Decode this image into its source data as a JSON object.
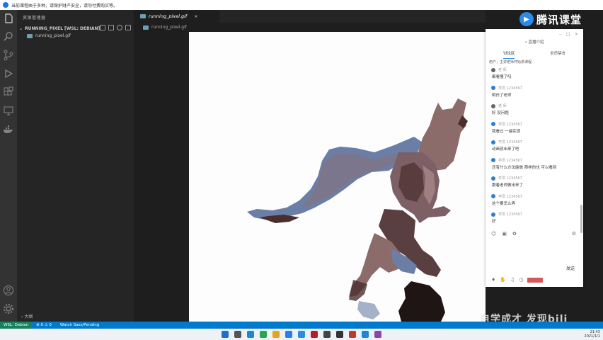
{
  "notice": {
    "text": "当前课程由于多种，请保护财产安全，请勿付费购买等。"
  },
  "explorer": {
    "header": "资源管理器",
    "folder": "RUNNING_PIXEL [WSL: DEBIAN]",
    "file": "running_pixel.gif",
    "outline": "大纲"
  },
  "editor": {
    "tab_label": "running_pixel.gif",
    "breadcrumb": "running_pixel.gif"
  },
  "status": {
    "remote": "WSL: Debian",
    "problems": "⊗ 0 ⚠ 0",
    "branch": "Watch Sass/Pending"
  },
  "brand": {
    "name": "腾讯课堂"
  },
  "chat": {
    "title": "• 直播介绍",
    "tab_discussion": "讨论区",
    "tab_other": "全员禁言",
    "top_line": "用户，主讲老师开始讲课程",
    "send_label": "发送",
    "messages": [
      {
        "user": "老 师",
        "text": "都看懂了吗",
        "teacher": true
      },
      {
        "user": "学员 1234567",
        "text": "明白了老师",
        "teacher": false
      },
      {
        "user": "老 师",
        "text": "好 没问题",
        "teacher": true
      },
      {
        "user": "学员 1234567",
        "text": "我看过 一遍实现",
        "teacher": false
      },
      {
        "user": "学员 1234567",
        "text": "动画就出来了吧",
        "teacher": false
      },
      {
        "user": "学员 1234567",
        "text": "还有什么方法能做 那样的也 可以看到",
        "teacher": false
      },
      {
        "user": "学员 1234567",
        "text": "跟着老师做出来了",
        "teacher": false
      },
      {
        "user": "学员 1234567",
        "text": "这个要怎么弄",
        "teacher": false
      },
      {
        "user": "学员 1234567",
        "text": "好",
        "teacher": false
      }
    ]
  },
  "watermark": "自学成才 发现bili",
  "clock": {
    "time": "21:43",
    "date": "2021/1/1"
  },
  "colors": {
    "accent": "#007acc",
    "remote": "#16825d",
    "brand": "#2b8be6",
    "sprite_blue": "#6b7fa6",
    "sprite_brown": "#8c6b6b",
    "sprite_dark": "#4a2e2e"
  }
}
